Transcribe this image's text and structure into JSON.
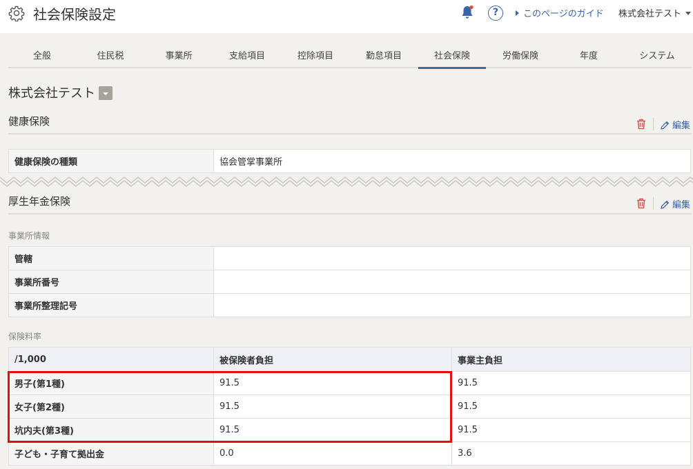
{
  "header": {
    "title": "社会保険設定",
    "help_symbol": "?",
    "guide_link": "このページのガイド",
    "company_menu": "株式会社テスト",
    "notification_color": "#e84c3d",
    "accent": "#3a63a8"
  },
  "tabs": [
    {
      "label": "全般"
    },
    {
      "label": "住民税"
    },
    {
      "label": "事業所"
    },
    {
      "label": "支給項目"
    },
    {
      "label": "控除項目"
    },
    {
      "label": "勤怠項目"
    },
    {
      "label": "社会保険",
      "active": true
    },
    {
      "label": "労働保険"
    },
    {
      "label": "年度"
    },
    {
      "label": "システム"
    }
  ],
  "company": {
    "name": "株式会社テスト"
  },
  "health_insurance": {
    "title": "健康保険",
    "edit_label": "編集",
    "rows": [
      {
        "label": "健康保険の種類",
        "value": "協会管掌事業所"
      }
    ]
  },
  "pension": {
    "title": "厚生年金保険",
    "edit_label": "編集",
    "office_info": {
      "heading": "事業所情報",
      "rows": [
        {
          "label": "管轄",
          "value": ""
        },
        {
          "label": "事業所番号",
          "value": ""
        },
        {
          "label": "事業所整理記号",
          "value": ""
        }
      ]
    },
    "rates": {
      "heading": "保険料率",
      "columns": [
        "/1,000",
        "被保険者負担",
        "事業主負担"
      ],
      "rows": [
        {
          "label": "男子(第1種)",
          "insured": "91.5",
          "employer": "91.5"
        },
        {
          "label": "女子(第2種)",
          "insured": "91.5",
          "employer": "91.5"
        },
        {
          "label": "坑内夫(第3種)",
          "insured": "91.5",
          "employer": "91.5"
        },
        {
          "label": "子ども・子育て拠出金",
          "insured": "0.0",
          "employer": "3.6"
        }
      ]
    }
  },
  "highlight_color": "#e30d12"
}
